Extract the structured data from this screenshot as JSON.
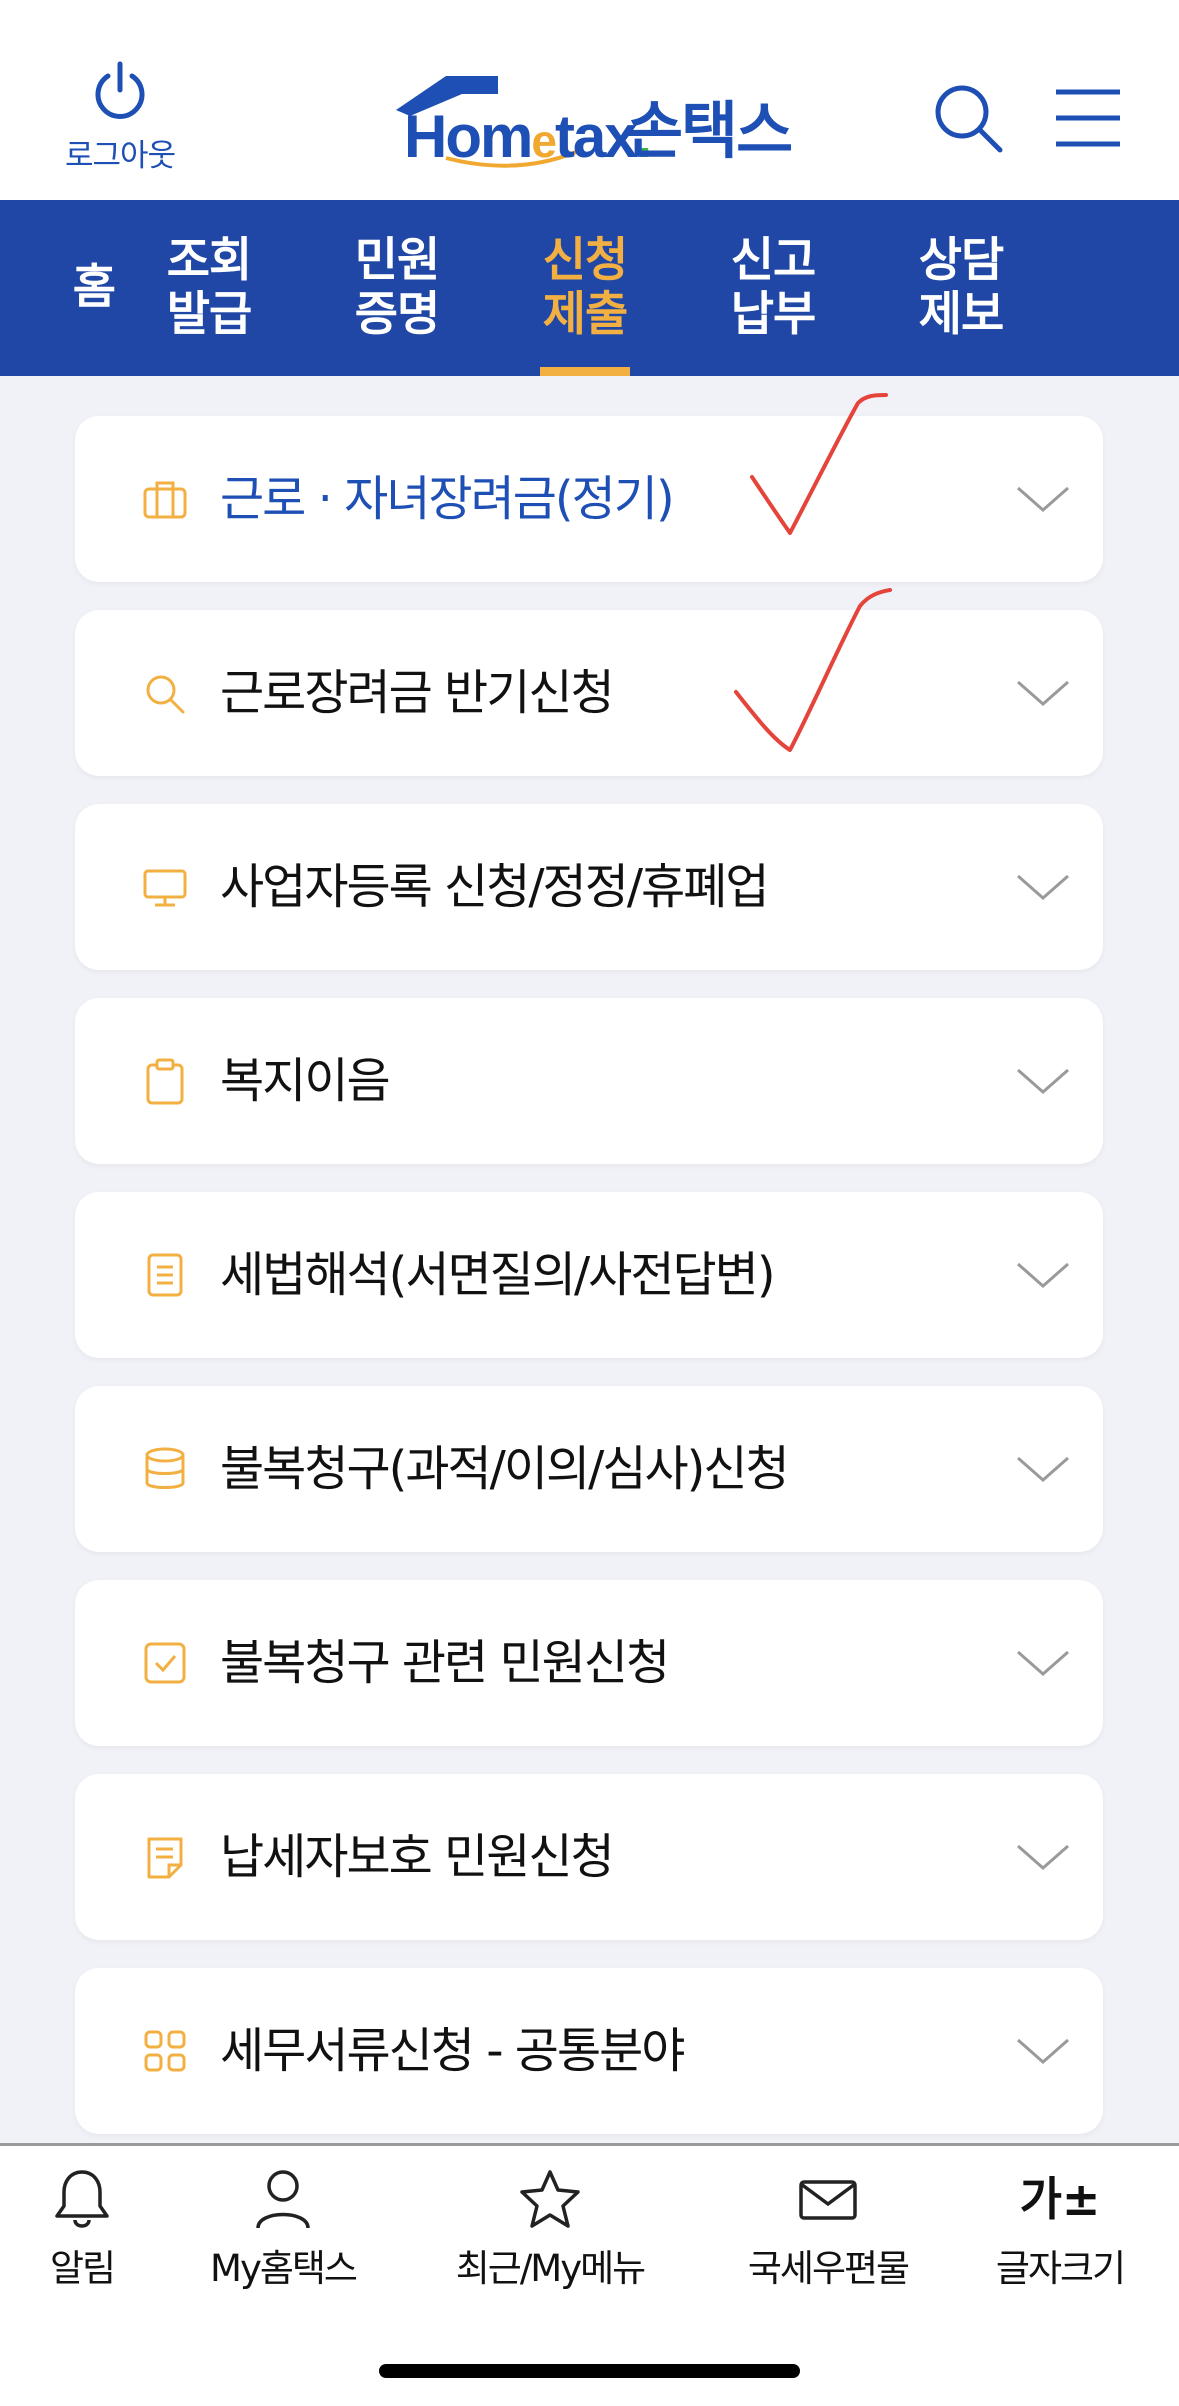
{
  "header": {
    "logout_label": "로그아웃",
    "logo_brand_part1": "Hom",
    "logo_brand_e": "e",
    "logo_brand_part2": "tax",
    "logo_brand_dot": ".",
    "app_name": "손택스",
    "search_icon": "search-icon",
    "menu_icon": "hamburger-menu-icon"
  },
  "nav": {
    "tabs": [
      {
        "label": "홈"
      },
      {
        "label": "조회\n발급"
      },
      {
        "label": "민원\n증명"
      },
      {
        "label": "신청\n제출",
        "active": true
      },
      {
        "label": "신고\n납부"
      },
      {
        "label": "상담\n제보"
      }
    ]
  },
  "list": {
    "items": [
      {
        "label": "근로 · 자녀장려금(정기)",
        "icon": "briefcase-icon",
        "selected": true
      },
      {
        "label": "근로장려금 반기신청",
        "icon": "search-icon"
      },
      {
        "label": "사업자등록 신청/정정/휴폐업",
        "icon": "monitor-icon"
      },
      {
        "label": "복지이음",
        "icon": "clipboard-icon"
      },
      {
        "label": "세법해석(서면질의/사전답변)",
        "icon": "document-icon"
      },
      {
        "label": "불복청구(과적/이의/심사)신청",
        "icon": "database-icon"
      },
      {
        "label": "불복청구 관련 민원신청",
        "icon": "checkbox-icon"
      },
      {
        "label": "납세자보호 민원신청",
        "icon": "note-icon"
      },
      {
        "label": "세무서류신청 - 공통분야",
        "icon": "grid-icon"
      }
    ]
  },
  "bottom_tabs": [
    {
      "label": "알림",
      "icon": "bell-icon"
    },
    {
      "label": "My홈택스",
      "icon": "user-icon"
    },
    {
      "label": "최근/My메뉴",
      "icon": "star-icon"
    },
    {
      "label": "국세우편물",
      "icon": "mail-icon"
    },
    {
      "label": "글자크기",
      "icon": "font-size-icon",
      "glyph": "가±"
    }
  ],
  "colors": {
    "brand_blue": "#2147a6",
    "accent_orange": "#f2b042",
    "check_red": "#e5443a"
  }
}
